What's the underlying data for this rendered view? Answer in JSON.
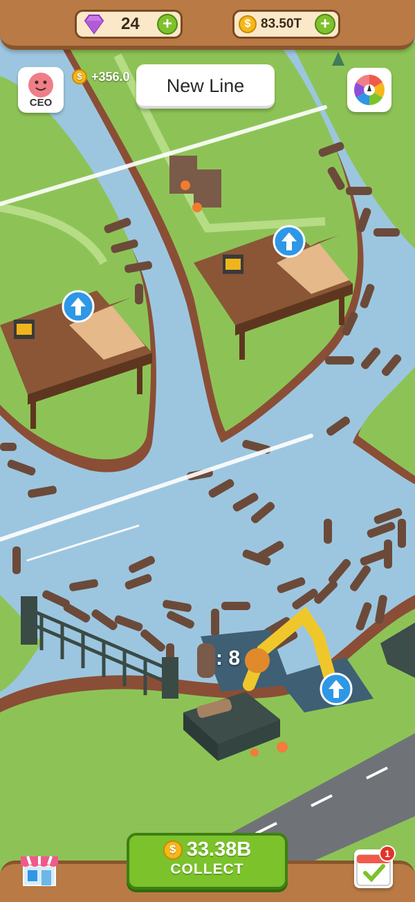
{
  "hud": {
    "gems": "24",
    "coins": "83.50T",
    "income": "+356.0",
    "ceo_label": "CEO",
    "new_line_label": "New Line",
    "plus_symbol": "+"
  },
  "machine": {
    "log_count": ": 8"
  },
  "collect": {
    "amount": "33.38B",
    "label": "COLLECT"
  },
  "calendar": {
    "badge": "1"
  },
  "colors": {
    "river": "#9cc6df",
    "grass": "#8dc356",
    "bank": "#9b5a3f",
    "wood_bar": "#b97a45",
    "collect_green": "#7bc22b",
    "upgrade_blue": "#2e97e6"
  }
}
